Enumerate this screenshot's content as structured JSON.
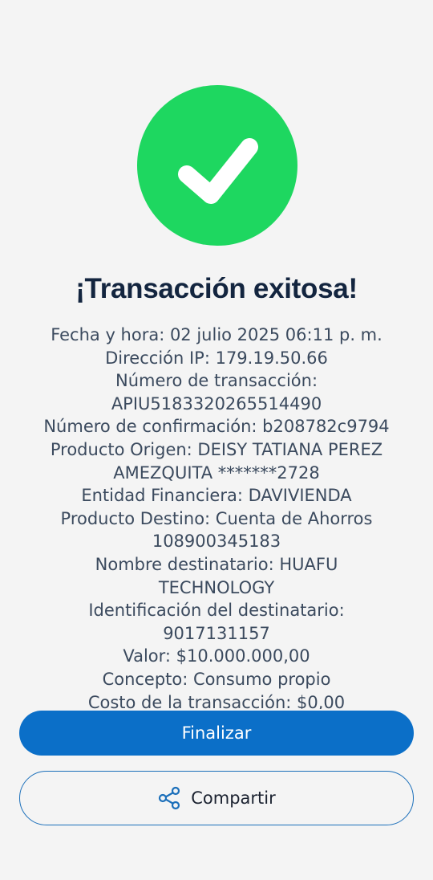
{
  "title": "¡Transacción exitosa!",
  "details": [
    "Fecha y hora: 02 julio 2025 06:11 p. m.",
    "Dirección IP: 179.19.50.66",
    "Número de transacción:",
    "APIU5183320265514490",
    "Número de confirmación: b208782c9794",
    "Producto Origen: DEISY TATIANA PEREZ",
    "AMEZQUITA *******2728",
    "Entidad Financiera: DAVIVIENDA",
    "Producto Destino: Cuenta de Ahorros",
    "108900345183",
    "Nombre destinatario: HUAFU",
    "TECHNOLOGY",
    "Identificación del destinatario:",
    "9017131157",
    "Valor: $10.000.000,00",
    "Concepto: Consumo propio",
    "Costo de la transacción: $0,00"
  ],
  "buttons": {
    "finalize": "Finalizar",
    "share": "Compartir"
  },
  "icons": {
    "success": "checkmark-icon",
    "share": "share-icon"
  },
  "colors": {
    "success": "#1ed760",
    "primary": "#0b6fc8",
    "title": "#13253f",
    "text": "#3b4a5e",
    "background": "#f4f4f4"
  }
}
